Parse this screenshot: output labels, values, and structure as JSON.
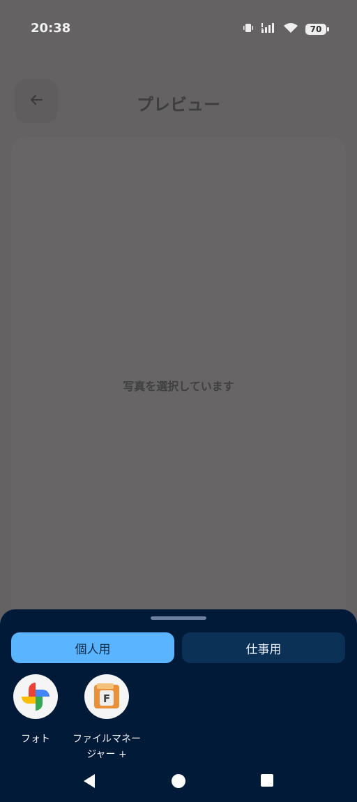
{
  "status_bar": {
    "time": "20:38",
    "battery": "70",
    "icons": [
      "vibrate-icon",
      "signal-icon",
      "wifi-icon",
      "battery-icon"
    ]
  },
  "header": {
    "back_icon": "arrow-left-icon",
    "title": "プレビュー"
  },
  "preview": {
    "message": "写真を選択しています"
  },
  "sheet": {
    "tabs": [
      {
        "label": "個人用",
        "selected": true
      },
      {
        "label": "仕事用",
        "selected": false
      }
    ],
    "apps": [
      {
        "label": "フォト",
        "icon": "google-photos-icon"
      },
      {
        "label": "ファイルマネージャー +",
        "icon": "file-manager-icon"
      }
    ]
  },
  "nav_bar": {
    "buttons": [
      "back-triangle-icon",
      "home-circle-icon",
      "recents-square-icon"
    ]
  },
  "colors": {
    "scrim": "#646262",
    "sheet_bg": "#001a38",
    "tab_selected": "#5ab4ff",
    "tab_unselected": "#0b3157"
  }
}
